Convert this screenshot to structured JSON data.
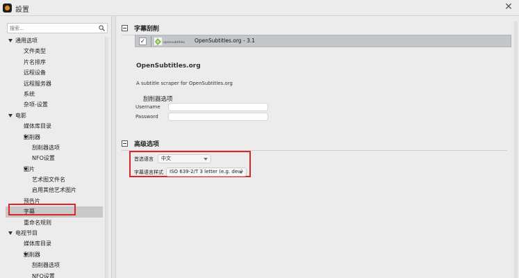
{
  "window": {
    "title": "設置"
  },
  "sidebar": {
    "search_placeholder": "搜索...",
    "tree": [
      {
        "label": "通用选项",
        "level": 0,
        "expanded": true
      },
      {
        "label": "文件类型",
        "level": 1
      },
      {
        "label": "片名排序",
        "level": 1
      },
      {
        "label": "远程设备",
        "level": 1
      },
      {
        "label": "远程服务器",
        "level": 1
      },
      {
        "label": "系统",
        "level": 1
      },
      {
        "label": "杂项-设置",
        "level": 1
      },
      {
        "label": "电影",
        "level": 0,
        "expanded": true
      },
      {
        "label": "媒体库目录",
        "level": 1
      },
      {
        "label": "刮削器",
        "level": 1,
        "expanded": true
      },
      {
        "label": "刮削器选项",
        "level": 2
      },
      {
        "label": "NFO设置",
        "level": 2
      },
      {
        "label": "图片",
        "level": 1,
        "expanded": true
      },
      {
        "label": "艺术图文件名",
        "level": 2
      },
      {
        "label": "启用其他艺术图片",
        "level": 2
      },
      {
        "label": "预告片",
        "level": 1
      },
      {
        "label": "字幕",
        "level": 1,
        "selected": true
      },
      {
        "label": "重命名规则",
        "level": 1
      },
      {
        "label": "电视节目",
        "level": 0,
        "expanded": true
      },
      {
        "label": "媒体库目录",
        "level": 1
      },
      {
        "label": "刮削器",
        "level": 1,
        "expanded": true
      },
      {
        "label": "刮削器选项",
        "level": 2
      },
      {
        "label": "NFO设置",
        "level": 2
      }
    ]
  },
  "main": {
    "subtitle_section": {
      "title": "字幕刮削",
      "scraper": {
        "checked": true,
        "logo_text": "opensubtitles",
        "name": "OpenSubtitles.org - 3.1"
      },
      "detail_title": "OpenSubtitles.org",
      "detail_desc": "A subtitle scraper for OpenSubtitles.org",
      "options_heading": "刮削器选项",
      "username_label": "Username",
      "username_value": "",
      "password_label": "Password",
      "password_value": ""
    },
    "advanced_section": {
      "title": "高级选项",
      "preferred_language_label": "首选语言",
      "preferred_language_value": "中文",
      "subtitle_language_style_label": "字幕语言样式",
      "subtitle_language_style_value": "ISO 639-2/T 3 letter (e.g. deu)"
    }
  },
  "colors": {
    "highlight_red": "#d9262b",
    "selected_row": "#c9c9c9",
    "scraper_row": "#c3c7cc"
  }
}
